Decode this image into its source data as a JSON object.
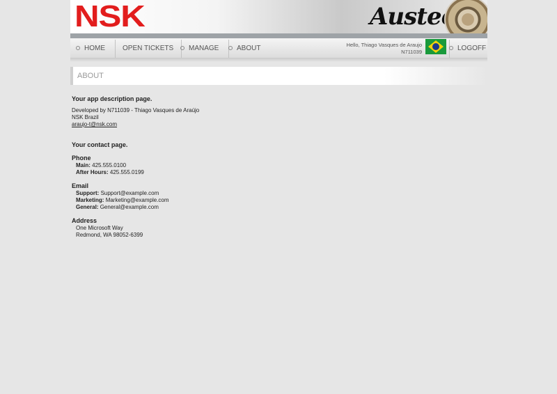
{
  "header": {
    "logo_text": "NSK",
    "brand_text": "Austec"
  },
  "nav": {
    "items": [
      "HOME",
      "OPEN TICKETS",
      "MANAGE",
      "ABOUT"
    ],
    "greeting": "Hello, Thiago Vasques de Araujo",
    "user_id": "N711039",
    "logoff": "LOGOFF",
    "flag_icon": "brazil-flag-icon"
  },
  "section": {
    "title": "ABOUT"
  },
  "about": {
    "heading": "Your app description page.",
    "developer": "Developed by N711039 - Thiago Vasques de Araújo",
    "company": "NSK Brazil",
    "email_link": "araujo-t@nsk.com"
  },
  "contact": {
    "heading": "Your contact page.",
    "phone_heading": "Phone",
    "main_label": "Main:",
    "main_value": "425.555.0100",
    "after_label": "After Hours:",
    "after_value": "425.555.0199",
    "email_heading": "Email",
    "support_label": "Support:",
    "support_value": "Support@example.com",
    "marketing_label": "Marketing:",
    "marketing_value": "Marketing@example.com",
    "general_label": "General:",
    "general_value": "General@example.com",
    "address_heading": "Address",
    "address_line1": "One Microsoft Way",
    "address_line2": "Redmond, WA 98052-6399"
  }
}
